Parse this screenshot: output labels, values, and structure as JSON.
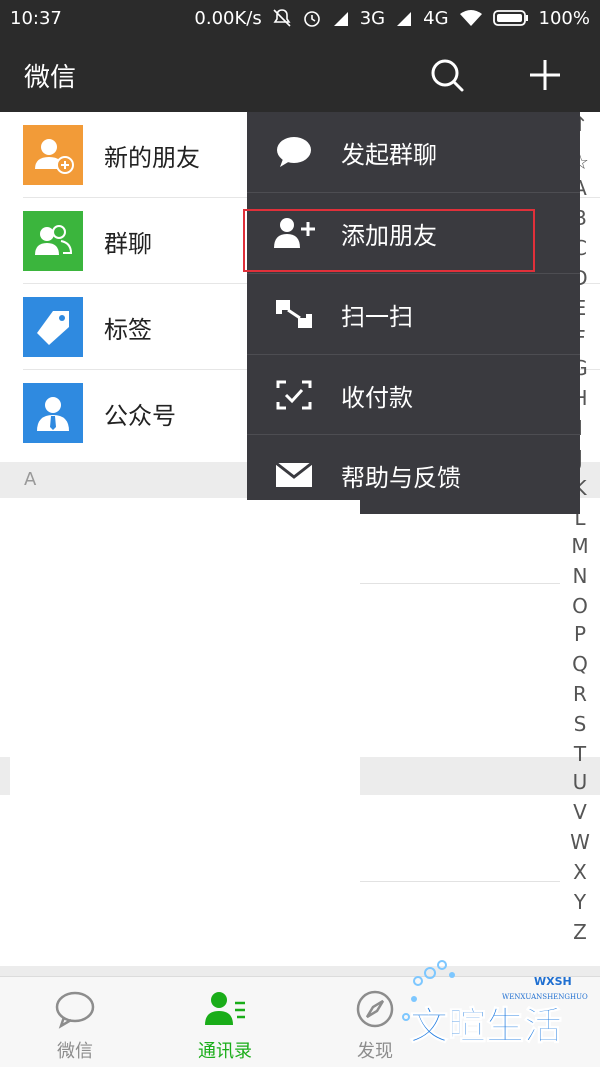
{
  "status_bar": {
    "time": "10:37",
    "net_speed": "0.00K/s",
    "network1": "3G",
    "network2": "4G",
    "battery": "100%"
  },
  "header": {
    "title": "微信",
    "search_icon": "search-icon",
    "add_icon": "plus-icon"
  },
  "contacts_top": [
    {
      "label": "新的朋友",
      "icon": "new-friend-icon",
      "color": "#f29b38"
    },
    {
      "label": "群聊",
      "icon": "group-chat-icon",
      "color": "#3bb53d"
    },
    {
      "label": "标签",
      "icon": "tag-icon",
      "color": "#2f8ae0"
    },
    {
      "label": "公众号",
      "icon": "official-account-icon",
      "color": "#2f8ae0"
    }
  ],
  "section_header": "A",
  "index_letters": [
    "↑",
    "☆",
    "A",
    "B",
    "C",
    "D",
    "E",
    "F",
    "G",
    "H",
    "I",
    "J",
    "K",
    "L",
    "M",
    "N",
    "O",
    "P",
    "Q",
    "R",
    "S",
    "T",
    "U",
    "V",
    "W",
    "X",
    "Y",
    "Z"
  ],
  "popup_menu": [
    {
      "label": "发起群聊",
      "icon": "chat-bubble-icon"
    },
    {
      "label": "添加朋友",
      "icon": "add-friend-icon",
      "highlighted": true
    },
    {
      "label": "扫一扫",
      "icon": "scan-icon"
    },
    {
      "label": "收付款",
      "icon": "payment-scan-icon"
    },
    {
      "label": "帮助与反馈",
      "icon": "envelope-icon"
    }
  ],
  "tabs": [
    {
      "label": "微信",
      "icon": "chat-tab-icon",
      "active": false
    },
    {
      "label": "通讯录",
      "icon": "contacts-tab-icon",
      "active": true
    },
    {
      "label": "发现",
      "icon": "discover-compass-icon",
      "active": false
    }
  ],
  "watermark": {
    "main": "文暄生活",
    "sub": "WENXUANSHENGHUO",
    "badge": "WXSH"
  },
  "colors": {
    "header_bg": "#2b2b2b",
    "menu_bg": "#3a3a3f",
    "accent_green": "#1aad19",
    "highlight_red": "#e0303a"
  }
}
